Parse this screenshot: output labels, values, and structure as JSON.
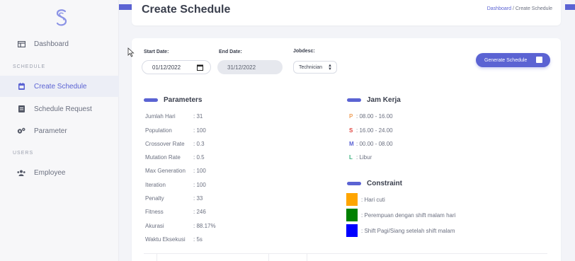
{
  "header": {
    "title": "Create Schedule",
    "breadcrumb_link": "Dashboard",
    "breadcrumb_sep": "/",
    "breadcrumb_current": "Create Schedule"
  },
  "sidebar": {
    "items": [
      {
        "label": "Dashboard",
        "icon": "dashboard-icon"
      },
      {
        "section": "SCHEDULE"
      },
      {
        "label": "Create Schedule",
        "icon": "calendar-icon",
        "active": true
      },
      {
        "label": "Schedule Request",
        "icon": "document-icon"
      },
      {
        "label": "Parameter",
        "icon": "gears-icon"
      },
      {
        "section": "USERS"
      },
      {
        "label": "Employee",
        "icon": "users-icon"
      }
    ]
  },
  "form": {
    "start_label": "Start Date:",
    "start_value": "01/12/2022",
    "end_label": "End Date:",
    "end_value": "31/12/2022",
    "jobdesc_label": "Jobdesc:",
    "jobdesc_value": "Technician",
    "generate_label": "Generate Schedule"
  },
  "parameters": {
    "title": "Parameters",
    "rows": [
      {
        "key": "Jumlah Hari",
        "value": ": 31"
      },
      {
        "key": "Population",
        "value": ": 100"
      },
      {
        "key": "Crossover Rate",
        "value": ": 0.3"
      },
      {
        "key": "Mutation Rate",
        "value": ": 0.5"
      },
      {
        "key": "Max Generation",
        "value": ": 100"
      },
      {
        "key": "Iteration",
        "value": ": 100"
      },
      {
        "key": "Penalty",
        "value": ": 33"
      },
      {
        "key": "Fitness",
        "value": ": 246"
      },
      {
        "key": "Akurasi",
        "value": ": 88.17%"
      },
      {
        "key": "Waktu Eksekusi",
        "value": ": 5s"
      }
    ]
  },
  "jam_kerja": {
    "title": "Jam Kerja",
    "rows": [
      {
        "code": "P",
        "text": ": 08.00 - 16.00",
        "color": "#f0a05a"
      },
      {
        "code": "S",
        "text": ": 16.00 - 24.00",
        "color": "#e0433e"
      },
      {
        "code": "M",
        "text": ": 00.00 - 08.00",
        "color": "#5b63d3"
      },
      {
        "code": "L",
        "text": ": Libur",
        "color": "#3fb27f"
      }
    ]
  },
  "constraint": {
    "title": "Constraint",
    "rows": [
      {
        "text": ": Hari cuti",
        "color": "#ffa500"
      },
      {
        "text": ": Perempuan dengan shift malam hari",
        "color": "#008000"
      },
      {
        "text": ": Shift Pagi/Siang setelah shift malam",
        "color": "#0000ff"
      }
    ]
  },
  "colors": {
    "accent": "#5b63d3"
  }
}
